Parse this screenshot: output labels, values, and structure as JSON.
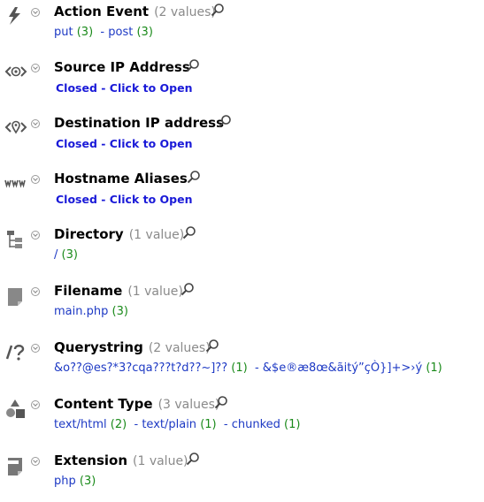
{
  "fields": [
    {
      "name": "Action Event",
      "count": "(2 values)",
      "icon": "lightning-icon",
      "values": [
        {
          "label": "put",
          "n": "(3)"
        },
        {
          "label": "post",
          "n": "(3)"
        }
      ]
    },
    {
      "name": "Source IP Address",
      "count": "",
      "icon": "source-ip-icon",
      "closed": "Closed - Click to Open"
    },
    {
      "name": "Destination IP address",
      "count": "",
      "icon": "destination-ip-icon",
      "closed": "Closed - Click to Open"
    },
    {
      "name": "Hostname Aliases",
      "count": "",
      "icon": "www-icon",
      "closed": "Closed - Click to Open"
    },
    {
      "name": "Directory",
      "count": "(1 value)",
      "icon": "directory-tree-icon",
      "values": [
        {
          "label": "/",
          "n": "(3)"
        }
      ]
    },
    {
      "name": "Filename",
      "count": "(1 value)",
      "icon": "file-icon",
      "values": [
        {
          "label": "main.php",
          "n": "(3)"
        }
      ]
    },
    {
      "name": "Querystring",
      "count": "(2 values)",
      "icon": "querystring-icon",
      "values": [
        {
          "label": "&o??@es?*3?cqa???t?d??~]??",
          "n": "(1)"
        },
        {
          "label": "&$e®æ8œ&ãitý”çÒ}]+>›ý",
          "n": "(1)"
        }
      ]
    },
    {
      "name": "Content Type",
      "count": "(3 values)",
      "icon": "content-type-icon",
      "values": [
        {
          "label": "text/html",
          "n": "(2)"
        },
        {
          "label": "text/plain",
          "n": "(1)"
        },
        {
          "label": "chunked",
          "n": "(1)"
        }
      ]
    },
    {
      "name": "Extension",
      "count": "(1 value)",
      "icon": "extension-icon",
      "values": [
        {
          "label": "php",
          "n": "(3)"
        }
      ]
    }
  ]
}
